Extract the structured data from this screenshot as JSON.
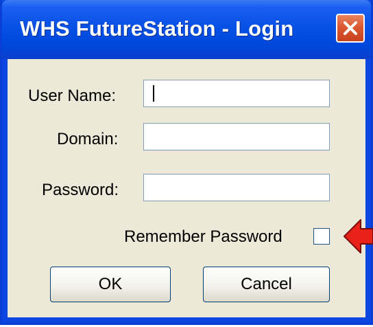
{
  "window": {
    "title": "WHS FutureStation - Login",
    "close_icon": "close-icon"
  },
  "form": {
    "username_label": "User Name:",
    "username_value": "",
    "domain_label": "Domain:",
    "domain_value": "",
    "password_label": "Password:",
    "password_value": "",
    "remember_label": "Remember Password",
    "remember_checked": false
  },
  "buttons": {
    "ok_label": "OK",
    "cancel_label": "Cancel"
  },
  "annotation": {
    "icon": "red-arrow-icon",
    "color": "#e8211b"
  },
  "colors": {
    "titlebar": "#0851e6",
    "client_bg": "#ece9d8",
    "close_button": "#db5a31"
  }
}
